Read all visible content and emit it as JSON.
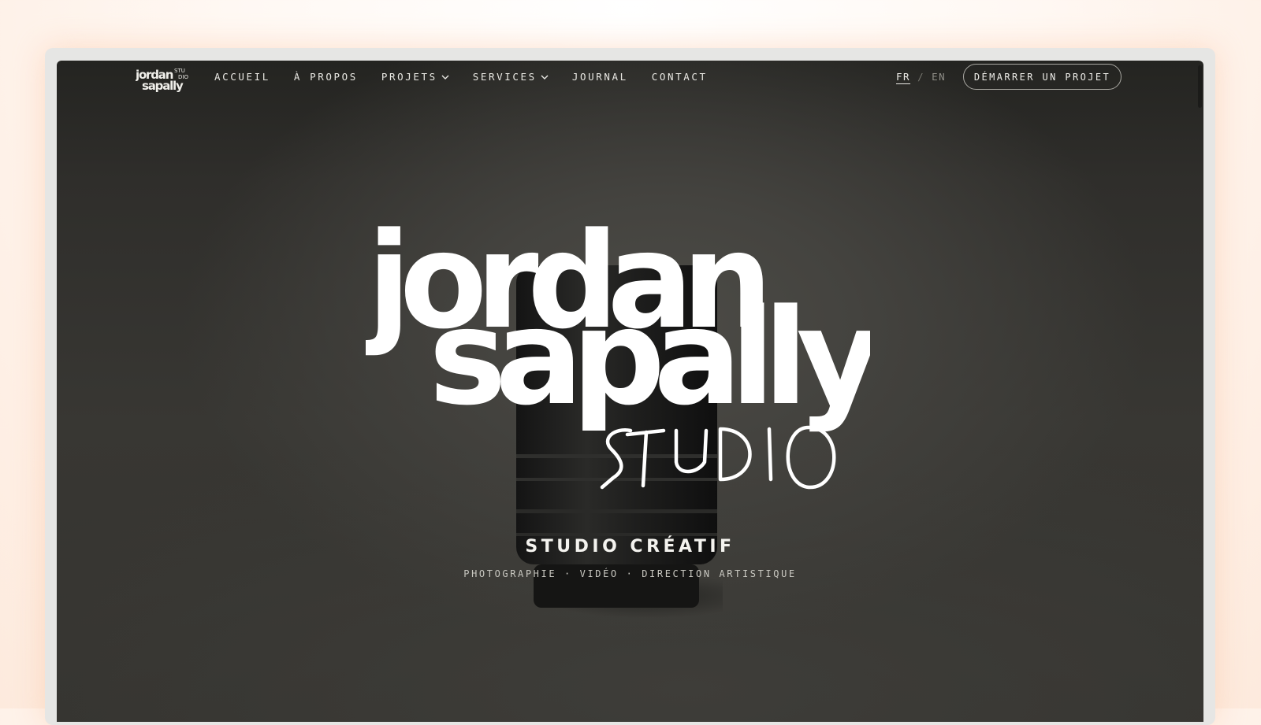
{
  "brand": {
    "logo_name": "jordan sapally",
    "logo_word_1": "jordan",
    "logo_word_2": "sapally",
    "logo_studio": "STUDIO"
  },
  "nav": {
    "items": [
      {
        "label": "ACCUEIL",
        "has_dropdown": false
      },
      {
        "label": "À PROPOS",
        "has_dropdown": false
      },
      {
        "label": "PROJETS",
        "has_dropdown": true
      },
      {
        "label": "SERVICES",
        "has_dropdown": true
      },
      {
        "label": "JOURNAL",
        "has_dropdown": false
      },
      {
        "label": "CONTACT",
        "has_dropdown": false
      }
    ],
    "lang_active": "FR",
    "lang_separator": "/",
    "lang_other": "EN",
    "cta_label": "DÉMARRER UN PROJET"
  },
  "hero": {
    "tagline": "STUDIO CRÉATIF",
    "subline": "PHOTOGRAPHIE · VIDÉO · DIRECTION ARTISTIQUE"
  },
  "colors": {
    "background_dark": "#383733",
    "text_light": "#f4f3ef",
    "page_glow": "#fdeadd"
  }
}
